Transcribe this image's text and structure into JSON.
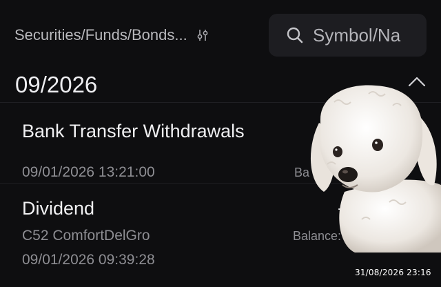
{
  "header": {
    "filter_label": "Securities/Funds/Bonds...",
    "filter_icon": "sliders-icon",
    "search": {
      "placeholder": "Symbol/Na",
      "icon": "search-icon"
    }
  },
  "group": {
    "month": "09/2026",
    "collapse_icon": "chevron-up-icon"
  },
  "transactions": [
    {
      "title": "Bank Transfer Withdrawals",
      "datetime": "09/01/2026 13:21:00",
      "balance_label": "Ba"
    },
    {
      "title": "Dividend",
      "security": "C52 ComfortDelGro",
      "datetime": "09/01/2026 09:39:28",
      "amount_prefix": "+",
      "balance_label": "Balance:"
    }
  ],
  "overlay": {
    "sticker": "dog-photo-sticker",
    "timestamp": "31/08/2026 23:16"
  },
  "colors": {
    "background": "#0e0e10",
    "search_bg": "#1d1d21",
    "primary_text": "#f0f0f2",
    "secondary_text": "#8e8e93"
  }
}
